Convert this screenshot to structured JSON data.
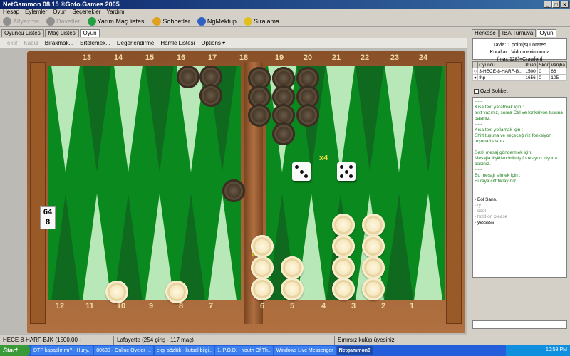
{
  "window": {
    "title": "NetGammon 08.15 ©Goto.Games 2005"
  },
  "menu": [
    "Hesap",
    "Eylemler",
    "Oyun",
    "Seçenekler",
    "Yardım"
  ],
  "toolbar": [
    {
      "label": "Altyazma",
      "disabled": true,
      "icon": "ok-icon",
      "color": "#909090"
    },
    {
      "label": "Davetler",
      "disabled": true,
      "icon": "invite-icon",
      "color": "#909090"
    },
    {
      "label": "Yarım Maç listesi",
      "disabled": false,
      "icon": "half-match-icon",
      "color": "#20a040"
    },
    {
      "label": "Sohbetler",
      "disabled": false,
      "icon": "chat-icon",
      "color": "#e0a020"
    },
    {
      "label": "NgMektup",
      "disabled": false,
      "icon": "mail-icon",
      "color": "#3060c0"
    },
    {
      "label": "Sıralama",
      "disabled": false,
      "icon": "ranking-icon",
      "color": "#e0c020"
    }
  ],
  "left_tabs": [
    "Oyuncu Listesi",
    "Maç Listesi",
    "Oyun"
  ],
  "right_tabs": [
    "Herkese",
    "IBA Turnuva",
    "Oyun"
  ],
  "game_toolbar": [
    {
      "label": "Teklif",
      "disabled": true
    },
    {
      "label": "Kabul",
      "disabled": true
    },
    {
      "label": "Bırakmak...",
      "disabled": false
    },
    {
      "label": "Ertelemek...",
      "disabled": false
    },
    {
      "label": "Değerlendirme",
      "disabled": false
    },
    {
      "label": "Hamle Listesi",
      "disabled": false
    },
    {
      "label": "Options ▾",
      "disabled": false
    }
  ],
  "board": {
    "top_numbers": [
      "13",
      "14",
      "15",
      "16",
      "17",
      "18",
      "19",
      "20",
      "21",
      "22",
      "23",
      "24"
    ],
    "bottom_numbers": [
      "12",
      "11",
      "10",
      "9",
      "8",
      "7",
      "6",
      "5",
      "4",
      "3",
      "2",
      "1"
    ],
    "cube": {
      "top": "64",
      "bottom": "8"
    },
    "multiplier": "x4",
    "dice": [
      3,
      5
    ],
    "colors": {
      "felt": "#0a8a1e",
      "dark_point": "#0f6a1f",
      "light_point": "#b8e8b8",
      "wood": "#a86a38"
    }
  },
  "info": {
    "line1": "Tavla: 1 point(s) unrated",
    "line2": "Kurallar : Vido maximumda (max.128)+Crawford"
  },
  "players_table": {
    "headers": [
      "",
      "Oyuncu",
      "Puan",
      "Skor",
      "Vanjba"
    ],
    "rows": [
      {
        "marker": "○",
        "name": "3-HECE-8-HARF-B..",
        "rating": "1500",
        "score": "0",
        "pips": "66"
      },
      {
        "marker": "●",
        "name": "fhp",
        "rating": "1656",
        "score": "0",
        "pips": "105"
      }
    ]
  },
  "private_chat_label": "Özel Sohbet",
  "chat_lines": [
    {
      "text": "-----",
      "style": "g"
    },
    {
      "text": "Kısa text yaratmak için :",
      "style": "g"
    },
    {
      "text": "text yazınız, sonra Ctrl ve fonksiyon tuşuna basınız.",
      "style": "g"
    },
    {
      "text": "-----",
      "style": "g"
    },
    {
      "text": "Kısa text yollamak için :",
      "style": "g"
    },
    {
      "text": "Shift tuşuna ve seçeceğiniz fonksiyon tuşuna basınız.",
      "style": "g"
    },
    {
      "text": "-----",
      "style": "g"
    },
    {
      "text": "Sesli mesaj göndermek için:",
      "style": "g"
    },
    {
      "text": "Mesajla ilişkilendirilmiş fonksiyon tuşuna basınız.",
      "style": "g"
    },
    {
      "text": "-----",
      "style": "g"
    },
    {
      "text": "Bu mesajı silmek için :",
      "style": "g"
    },
    {
      "text": "Buraya çift tıklayınız.",
      "style": "g"
    },
    {
      "text": "- Bol Şans.",
      "style": "blk"
    },
    {
      "text": "- ty",
      "style": "grey"
    },
    {
      "text": "- cool",
      "style": "grey"
    },
    {
      "text": "- hold on please",
      "style": "grey"
    },
    {
      "text": "- yesssss",
      "style": "blk"
    }
  ],
  "status": {
    "player": "HECE-8-HARF-BJK (1500.00 -",
    "opponent": "Lafayette (254 giriş - 117 maç)",
    "message": "Sınırsız kulüp üyesiniz"
  },
  "taskbar": {
    "start": "Start",
    "tasks": [
      {
        "label": "DTP kapatılır mı? - Huriy.."
      },
      {
        "label": "80630 - Online Oyeler -.."
      },
      {
        "label": "ekşi sözlük - kutsal bilgi.."
      },
      {
        "label": "1. P.O.D. - Youth Of Th.."
      },
      {
        "label": "Windows Live Messenger"
      },
      {
        "label": "Netgammon8"
      }
    ],
    "clock": "10:58 PM"
  }
}
